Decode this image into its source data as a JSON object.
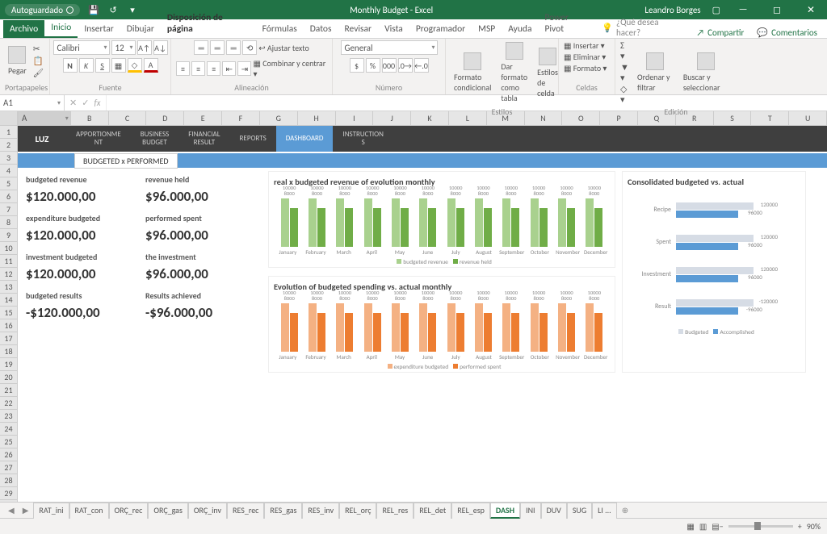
{
  "titlebar": {
    "autosave": "Autoguardado",
    "title": "Monthly Budget - Excel",
    "user": "Leandro Borges"
  },
  "ribbon_tabs": {
    "file": "Archivo",
    "home": "Inicio",
    "insert": "Insertar",
    "draw": "Dibujar",
    "layout": "Disposición de página",
    "formulas": "Fórmulas",
    "data": "Datos",
    "review": "Revisar",
    "view": "Vista",
    "developer": "Programador",
    "msp": "MSP",
    "help": "Ayuda",
    "powerpivot": "Power Pivot",
    "search": "¿Qué desea hacer?",
    "share": "Compartir",
    "comments": "Comentarios"
  },
  "ribbon": {
    "paste": "Pegar",
    "clipboard": "Portapapeles",
    "font_name": "Calibri",
    "font_size": "12",
    "font": "Fuente",
    "alignment": "Alineación",
    "wrap": "Ajustar texto",
    "merge": "Combinar y centrar",
    "number_format": "General",
    "number": "Número",
    "cond": "Formato condicional",
    "table": "Dar formato como tabla",
    "cell_styles": "Estilos de celda",
    "styles": "Estilos",
    "insert_c": "Insertar",
    "delete_c": "Eliminar",
    "format_c": "Formato",
    "cells": "Celdas",
    "sort": "Ordenar y filtrar",
    "find": "Buscar y seleccionar",
    "editing": "Edición"
  },
  "namebox": "A1",
  "columns": [
    "A",
    "B",
    "C",
    "D",
    "E",
    "F",
    "G",
    "H",
    "I",
    "J",
    "K",
    "L",
    "M",
    "N",
    "O",
    "P",
    "Q",
    "R",
    "S",
    "T",
    "U"
  ],
  "rows_count": 29,
  "dash": {
    "tabs": [
      "APPORTIONME\nNT",
      "BUSINESS\nBUDGET",
      "FINANCIAL\nRESULT",
      "REPORTS",
      "DASHBOARD",
      "INSTRUCTION\nS"
    ],
    "active_tab": 4,
    "logo": "LUZ",
    "subbtn": "BUDGETED x PERFORMED",
    "cards": [
      {
        "l1": "budgeted revenue",
        "v1": "$120.000,00",
        "l2": "revenue held",
        "v2": "$96.000,00"
      },
      {
        "l1": "expenditure budgeted",
        "v1": "$120.000,00",
        "l2": "performed spent",
        "v2": "$96.000,00"
      },
      {
        "l1": "investment budgeted",
        "v1": "$120.000,00",
        "l2": "the investment",
        "v2": "$96.000,00"
      },
      {
        "l1": "budgeted results",
        "v1": "-$120.000,00",
        "l2": "Results achieved",
        "v2": "-$96.000,00"
      }
    ],
    "chart1": {
      "title": "real x budgeted revenue of evolution monthly",
      "legend": [
        "budgeted revenue",
        "revenue held"
      ]
    },
    "chart2": {
      "title": "Evolution of budgeted spending vs. actual monthly",
      "legend": [
        "expenditure budgeted",
        "performed spent"
      ]
    },
    "chart3": {
      "title": "Consolidated budgeted vs. actual",
      "rows": [
        "Recipe",
        "Spent",
        "Investment",
        "Result"
      ],
      "legend": [
        "Budgeted",
        "Accomplished"
      ]
    },
    "months": [
      "January",
      "February",
      "March",
      "April",
      "May",
      "June",
      "July",
      "August",
      "September",
      "October",
      "November",
      "December"
    ]
  },
  "chart_data": [
    {
      "type": "bar",
      "title": "real x budgeted revenue of evolution monthly",
      "categories": [
        "January",
        "February",
        "March",
        "April",
        "May",
        "June",
        "July",
        "August",
        "September",
        "October",
        "November",
        "December"
      ],
      "series": [
        {
          "name": "budgeted revenue",
          "values": [
            10000,
            10000,
            10000,
            10000,
            10000,
            10000,
            10000,
            10000,
            10000,
            10000,
            10000,
            10000
          ]
        },
        {
          "name": "revenue held",
          "values": [
            8000,
            8000,
            8000,
            8000,
            8000,
            8000,
            8000,
            8000,
            8000,
            8000,
            8000,
            8000
          ]
        }
      ],
      "ylim": [
        0,
        10000
      ]
    },
    {
      "type": "bar",
      "title": "Evolution of budgeted spending vs. actual monthly",
      "categories": [
        "January",
        "February",
        "March",
        "April",
        "May",
        "June",
        "July",
        "August",
        "September",
        "October",
        "November",
        "December"
      ],
      "series": [
        {
          "name": "expenditure budgeted",
          "values": [
            10000,
            10000,
            10000,
            10000,
            10000,
            10000,
            10000,
            10000,
            10000,
            10000,
            10000,
            10000
          ]
        },
        {
          "name": "performed spent",
          "values": [
            8000,
            8000,
            8000,
            8000,
            8000,
            8000,
            8000,
            8000,
            8000,
            8000,
            8000,
            8000
          ]
        }
      ],
      "ylim": [
        0,
        10000
      ]
    },
    {
      "type": "bar",
      "title": "Consolidated budgeted vs. actual",
      "orientation": "horizontal",
      "categories": [
        "Recipe",
        "Spent",
        "Investment",
        "Result"
      ],
      "series": [
        {
          "name": "Budgeted",
          "values": [
            120000,
            120000,
            120000,
            -120000
          ]
        },
        {
          "name": "Accomplished",
          "values": [
            96000,
            96000,
            96000,
            -96000
          ]
        }
      ]
    }
  ],
  "sheets": [
    "RAT_ini",
    "RAT_con",
    "ORÇ_rec",
    "ORÇ_gas",
    "ORÇ_inv",
    "RES_rec",
    "RES_gas",
    "RES_inv",
    "REL_orç",
    "REL_res",
    "REL_det",
    "REL_esp",
    "DASH",
    "INI",
    "DUV",
    "SUG",
    "LI ..."
  ],
  "active_sheet": 12,
  "status": {
    "zoom": "90%"
  }
}
